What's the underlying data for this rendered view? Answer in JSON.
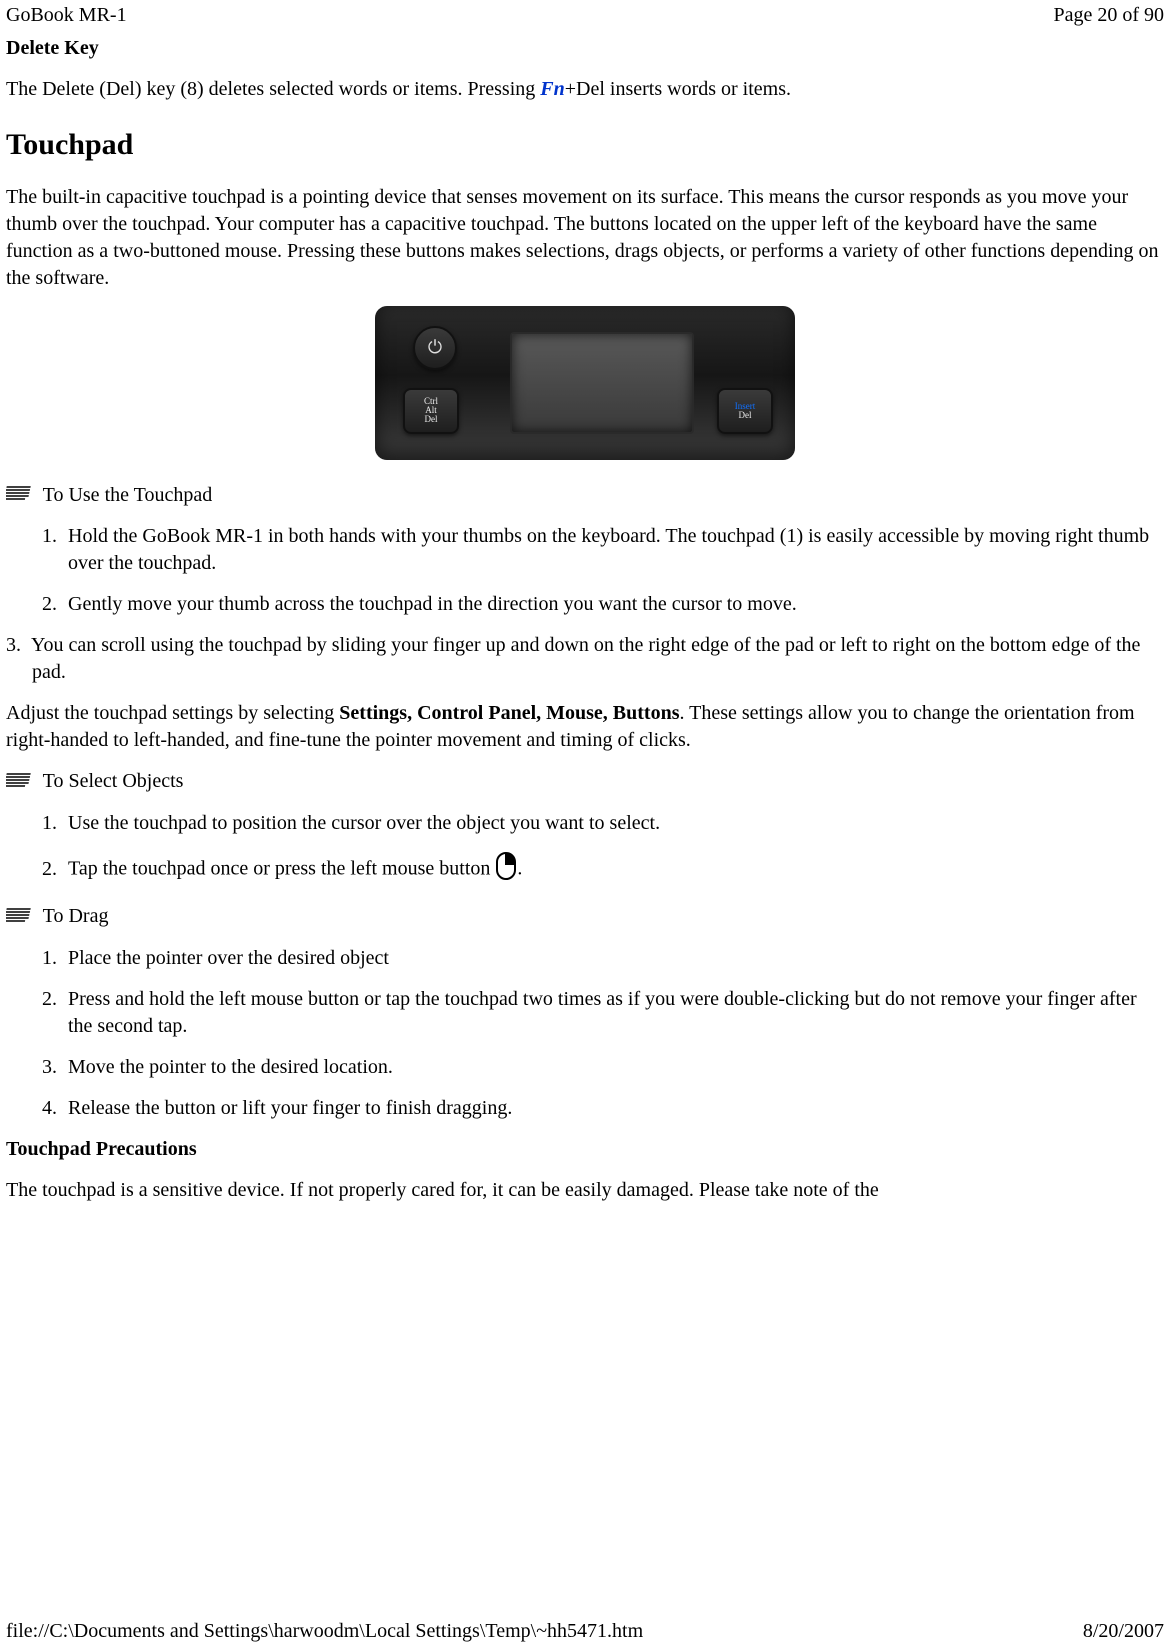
{
  "header": {
    "left": "GoBook MR-1",
    "right": "Page 20 of 90"
  },
  "delete_key": {
    "title": "Delete Key",
    "para_a": "The Delete (Del) key (8) deletes selected words or items.  Pressing ",
    "fn": "Fn",
    "para_b": "+Del inserts words or items."
  },
  "touchpad": {
    "title": "Touchpad",
    "intro": "The built-in capacitive touchpad is a pointing device that senses movement on its surface. This means the cursor responds as you move your thumb over the touchpad. Your computer has a  capacitive touchpad.  The buttons located on the upper left of the keyboard have the same function as a two-buttoned mouse. Pressing these buttons makes selections, drags objects, or performs a variety of other functions depending on the software."
  },
  "photo": {
    "power": "⏻",
    "cad1": "Ctrl",
    "cad2": "Alt",
    "cad3": "Del",
    "del_blue": "Insert",
    "del_white": "Del"
  },
  "use": {
    "heading": " To Use the Touchpad",
    "s1": "Hold the GoBook MR-1 in both hands with your  thumbs on the keyboard. The touchpad (1) is easily accessible by moving right thumb over the touchpad.",
    "s2": "Gently move your thumb across the touchpad in the direction you want the cursor to move.",
    "s3_marker": "3.",
    "s3": "You can scroll using the touchpad by sliding your finger up and down on the right edge of the pad or left to right on the bottom edge of the pad.",
    "settings_a": "Adjust the touchpad settings by selecting ",
    "settings_bold": "Settings, Control Panel, Mouse, Buttons",
    "settings_b": ". These settings allow you to change the orientation from right-handed to left-handed, and fine-tune the pointer movement and timing of clicks."
  },
  "select": {
    "heading": " To Select Objects",
    "s1": "Use the touchpad to position the cursor over the object you want to select.",
    "s2a": "Tap the touchpad once or press the left mouse button ",
    "s2b": "."
  },
  "drag": {
    "heading": " To Drag",
    "s1": "Place the pointer over the desired object",
    "s2": "Press and hold the left mouse button or tap the touchpad two times as if you were double-clicking but do not remove your finger after the second tap.",
    "s3": "Move the pointer to the desired location.",
    "s4": " Release the button or lift your finger to finish dragging."
  },
  "precautions": {
    "title": "Touchpad Precautions",
    "para": "The touchpad is a sensitive device.  If not properly cared for, it can be easily damaged. Please take note of the"
  },
  "footer": {
    "left": "file://C:\\Documents and Settings\\harwoodm\\Local Settings\\Temp\\~hh5471.htm",
    "right": "8/20/2007"
  }
}
